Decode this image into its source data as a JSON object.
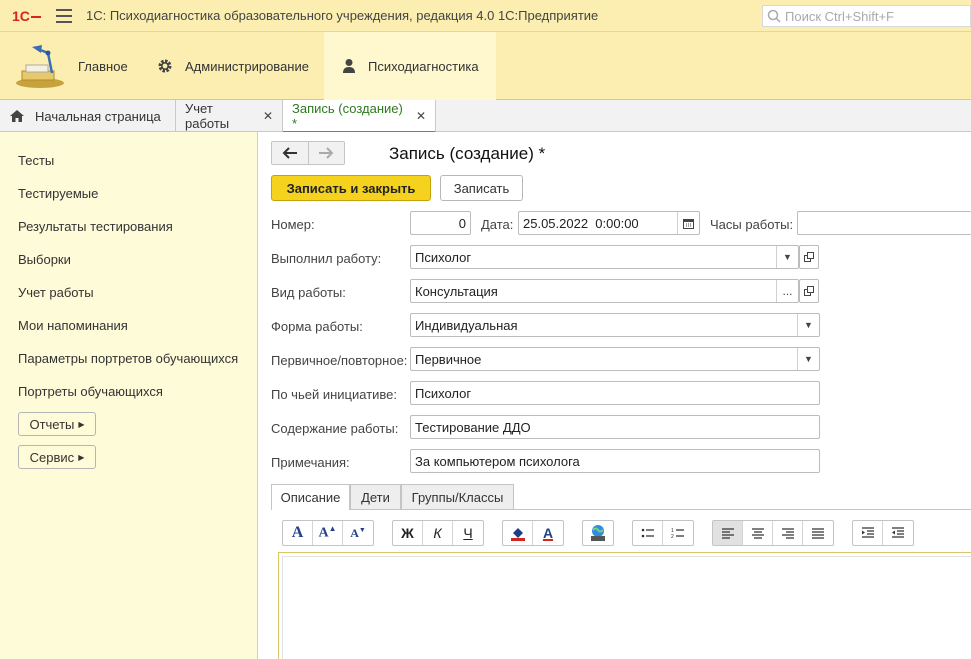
{
  "titlebar": {
    "title": "1С: Психодиагностика образовательного учреждения, редакция 4.0 1С:Предприятие",
    "search_placeholder": "Поиск Ctrl+Shift+F"
  },
  "sections": [
    {
      "label": "Главное",
      "icon": "desk-lamp-icon"
    },
    {
      "label": "Администрирование",
      "icon": "gear-icon"
    },
    {
      "label": "Психодиагностика",
      "icon": "person-icon",
      "active": true
    }
  ],
  "open_tabs": [
    {
      "label": "Начальная страница",
      "icon": "home-icon"
    },
    {
      "label": "Учет работы",
      "closable": true
    },
    {
      "label": "Запись (создание) *",
      "closable": true,
      "active": true
    }
  ],
  "left_nav": {
    "items": [
      "Тесты",
      "Тестируемые",
      "Результаты тестирования",
      "Выборки",
      "Учет работы",
      "Мои напоминания",
      "Параметры портретов обучающихся",
      "Портреты обучающихся"
    ],
    "buttons": [
      "Отчеты",
      "Сервис"
    ]
  },
  "form": {
    "title": "Запись (создание) *",
    "save_close_label": "Записать и закрыть",
    "save_label": "Записать",
    "fields": {
      "number": {
        "label": "Номер:",
        "value": "0"
      },
      "date": {
        "label": "Дата:",
        "value": "25.05.2022  0:00:00"
      },
      "hours": {
        "label": "Часы работы:",
        "value": ""
      },
      "performer": {
        "label": "Выполнил работу:",
        "value": "Психолог"
      },
      "work_type": {
        "label": "Вид работы:",
        "value": "Консультация"
      },
      "work_form": {
        "label": "Форма работы:",
        "value": "Индивидуальная"
      },
      "primary": {
        "label": "Первичное/повторное:",
        "value": "Первичное"
      },
      "initiative": {
        "label": "По чьей инициативе:",
        "value": "Психолог"
      },
      "content": {
        "label": "Содержание работы:",
        "value": "Тестирование ДДО"
      },
      "notes": {
        "label": "Примечания:",
        "value": "За компьютером психолога"
      }
    },
    "tabs": [
      "Описание",
      "Дети",
      "Группы/Классы"
    ],
    "toolbar": {
      "bold_label": "Ж",
      "italic_label": "К",
      "underline_label": "Ч"
    }
  },
  "colors": {
    "accent_yellow": "#f4d21e",
    "panel_yellow": "#fbeeb0",
    "nav_bg": "#fefbd9",
    "active_tab_line": "#5a9a30",
    "logo_red": "#d4261e"
  }
}
